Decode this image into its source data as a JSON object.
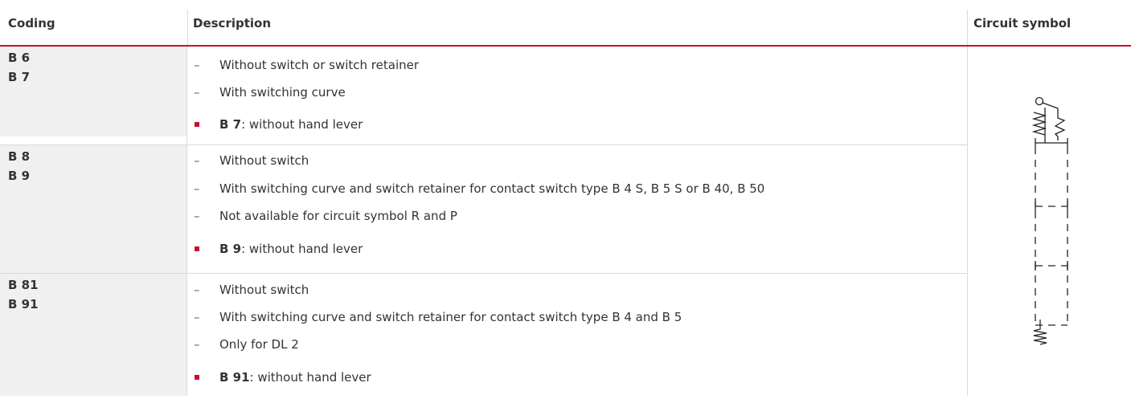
{
  "headers": {
    "coding": "Coding",
    "description": "Description",
    "circuit_symbol": "Circuit symbol"
  },
  "rows": [
    {
      "coding": [
        "B 6",
        "B 7"
      ],
      "items": [
        {
          "type": "dash",
          "text": "Without switch or switch retainer"
        },
        {
          "type": "dash",
          "text": "With switching curve"
        },
        {
          "type": "bullet",
          "bold": "B 7",
          "text": ": without hand lever"
        }
      ]
    },
    {
      "coding": [
        "B 8",
        "B 9"
      ],
      "items": [
        {
          "type": "dash",
          "text": "Without switch"
        },
        {
          "type": "dash",
          "text": "With switching curve and switch retainer for contact switch type B 4 S, B 5 S or B 40, B 50"
        },
        {
          "type": "dash",
          "text": "Not available for circuit symbol R and P"
        },
        {
          "type": "bullet",
          "bold": "B 9",
          "text": ": without hand lever"
        }
      ]
    },
    {
      "coding": [
        "B 81",
        "B 91"
      ],
      "items": [
        {
          "type": "dash",
          "text": "Without switch"
        },
        {
          "type": "dash",
          "text": "With switching curve and switch retainer for contact switch type B 4 and B 5"
        },
        {
          "type": "dash",
          "text": "Only for DL 2"
        },
        {
          "type": "bullet",
          "bold": "B 91",
          "text": ": without hand lever"
        }
      ]
    }
  ],
  "symbols": {
    "dash_char": "–"
  },
  "colors": {
    "accent": "#c8102e",
    "coding_bg": "#f0f0f0",
    "text": "#333333",
    "border": "#d9d9d9"
  }
}
